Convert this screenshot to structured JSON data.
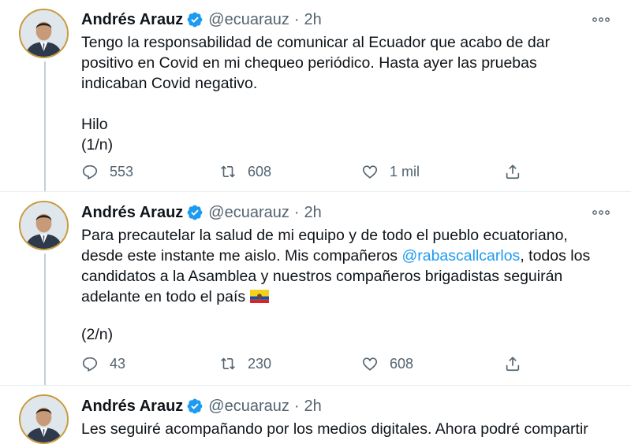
{
  "colors": {
    "mention": "#1d9bf0",
    "muted": "#536471",
    "text": "#0f1419",
    "verified": "#1d9bf0"
  },
  "icons": {
    "verified": "verified-badge-icon",
    "reply": "reply-icon",
    "retweet": "retweet-icon",
    "like": "heart-icon",
    "share": "share-icon",
    "more": "more-options-icon"
  },
  "tweets": [
    {
      "author_name": "Andrés Arauz",
      "handle": "@ecuarauz",
      "separator": "·",
      "time": "2h",
      "text": "Tengo la responsabilidad de comunicar al Ecuador que acabo de dar\npositivo en Covid en mi chequeo periódico. Hasta ayer las pruebas\nindicaban Covid negativo.\n\nHilo\n(1/n)",
      "replies": "553",
      "retweets": "608",
      "likes": "1 mil"
    },
    {
      "author_name": "Andrés Arauz",
      "handle": "@ecuarauz",
      "separator": "·",
      "time": "2h",
      "text_before_mention": "Para precautelar la salud de mi equipo y de todo el pueblo ecuatoriano,\ndesde este instante me aislo. Mis compañeros ",
      "mention": "@rabascallcarlos",
      "text_after_mention": ", todos los\ncandidatos a la Asamblea y nuestros compañeros brigadistas seguirán\nadelante en todo el país",
      "text_footer": "(2/n)",
      "replies": "43",
      "retweets": "230",
      "likes": "608"
    },
    {
      "author_name": "Andrés Arauz",
      "handle": "@ecuarauz",
      "separator": "·",
      "time": "2h",
      "text": "Les seguiré acompañando por los medios digitales. Ahora podré compartir"
    }
  ]
}
